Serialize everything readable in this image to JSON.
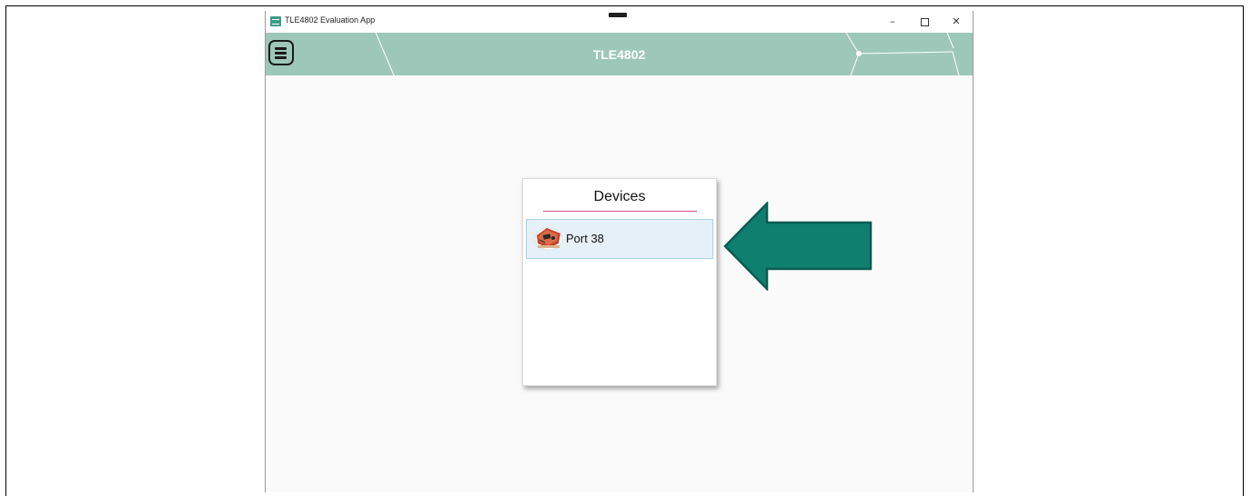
{
  "window": {
    "title": "TLE4802 Evaluation App",
    "controls": {
      "minimize": "–",
      "close": "✕"
    }
  },
  "header": {
    "title": "TLE4802",
    "background": "#9dc7b9",
    "menu_icon": "hamburger-menu-icon"
  },
  "devices_panel": {
    "heading": "Devices",
    "accent": "#c8548a",
    "items": [
      {
        "label": "Port 38",
        "icon": "evaluation-board-icon"
      }
    ]
  },
  "annotation": {
    "icon": "left-pointing-arrow",
    "color": "#0f7f6f"
  }
}
